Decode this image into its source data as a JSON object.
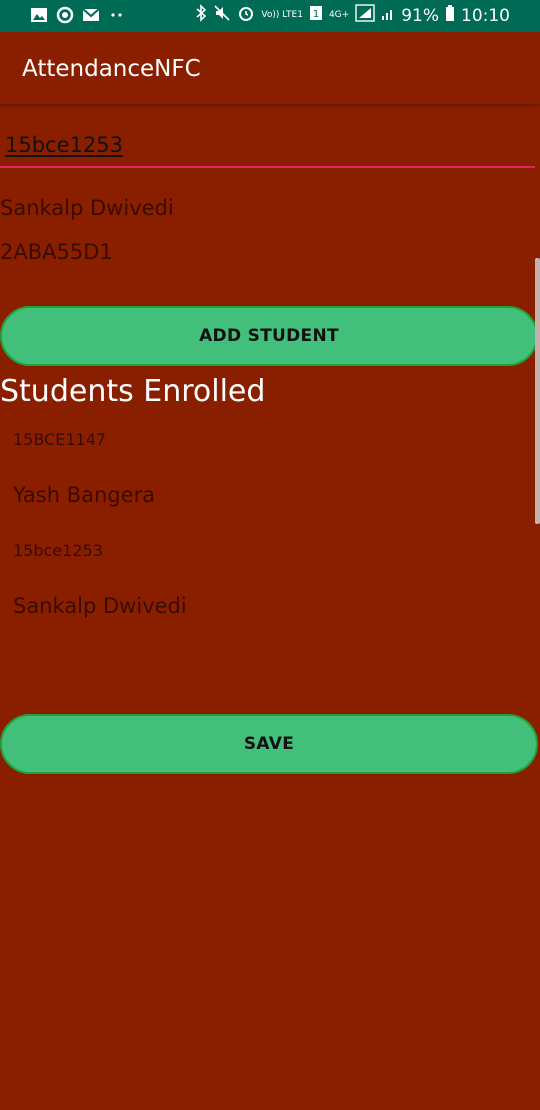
{
  "status_bar": {
    "battery": "91%",
    "time": "10:10",
    "left_icons": [
      "image-icon",
      "sync-icon",
      "mail-icon",
      "dots-icon"
    ],
    "network_volte": "Vo)) LTE1",
    "network_4g": "4G+"
  },
  "app_bar": {
    "title": "AttendanceNFC"
  },
  "form": {
    "reg_input_value": "15bce1253",
    "student_name": "Sankalp Dwivedi",
    "nfc_tag": "2ABA55D1",
    "add_button_label": "ADD STUDENT"
  },
  "enrolled": {
    "title": "Students Enrolled",
    "items": [
      {
        "reg": "15BCE1147",
        "name": "Yash Bangera"
      },
      {
        "reg": "15bce1253",
        "name": "Sankalp Dwivedi"
      }
    ]
  },
  "save_button_label": "SAVE",
  "colors": {
    "background": "#8a1f00",
    "status_bar": "#006b55",
    "button": "#41bf7b",
    "input_underline": "#e8206b"
  }
}
